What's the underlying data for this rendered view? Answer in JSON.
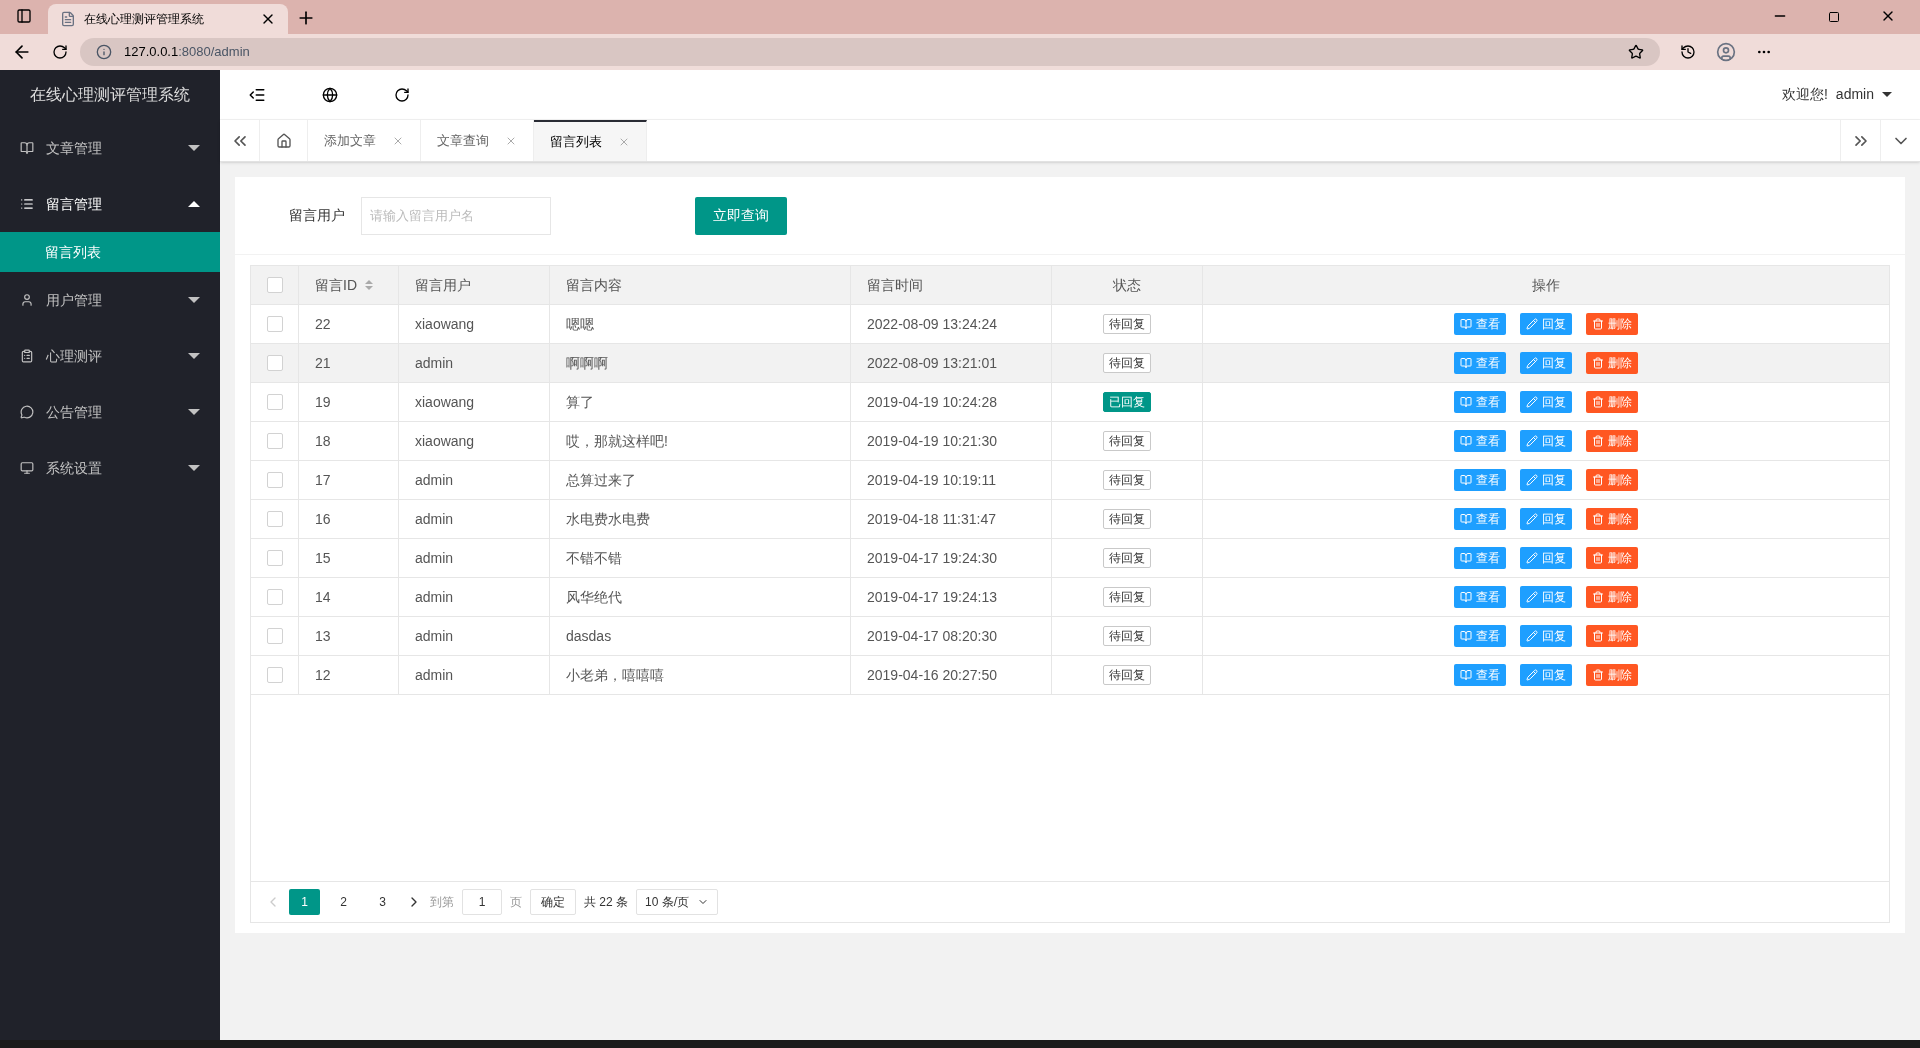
{
  "browser": {
    "tab_title": "在线心理测评管理系统",
    "url_host": "127.0.0.1",
    "url_rest": ":8080/admin"
  },
  "sidebar": {
    "title": "在线心理测评管理系统",
    "items": [
      {
        "label": "文章管理",
        "expanded": false
      },
      {
        "label": "留言管理",
        "expanded": true,
        "children": [
          {
            "label": "留言列表",
            "selected": true
          }
        ]
      },
      {
        "label": "用户管理",
        "expanded": false
      },
      {
        "label": "心理测评",
        "expanded": false
      },
      {
        "label": "公告管理",
        "expanded": false
      },
      {
        "label": "系统设置",
        "expanded": false
      }
    ]
  },
  "header": {
    "welcome": "欢迎您!",
    "user": "admin"
  },
  "tabs": [
    {
      "label": "添加文章",
      "selected": false
    },
    {
      "label": "文章查询",
      "selected": false
    },
    {
      "label": "留言列表",
      "selected": true
    }
  ],
  "search": {
    "label": "留言用户",
    "placeholder": "请输入留言用户名",
    "button": "立即查询"
  },
  "table": {
    "select_all": false,
    "columns": [
      "留言ID",
      "留言用户",
      "留言内容",
      "留言时间",
      "状态",
      "操作"
    ],
    "rows": [
      {
        "id": "22",
        "user": "xiaowang",
        "content": "嗯嗯",
        "time": "2022-08-09 13:24:24",
        "status": "待回复",
        "replied": false,
        "checked": false,
        "selected": false,
        "actions": [
          {
            "label": "查看",
            "kind": "view"
          },
          {
            "label": "回复",
            "kind": "reply"
          },
          {
            "label": "删除",
            "kind": "delete"
          }
        ]
      },
      {
        "id": "21",
        "user": "admin",
        "content": "啊啊啊",
        "time": "2022-08-09 13:21:01",
        "status": "待回复",
        "replied": false,
        "checked": false,
        "selected": true,
        "actions": [
          {
            "label": "查看",
            "kind": "view"
          },
          {
            "label": "回复",
            "kind": "reply"
          },
          {
            "label": "删除",
            "kind": "delete"
          }
        ]
      },
      {
        "id": "19",
        "user": "xiaowang",
        "content": "算了",
        "time": "2019-04-19 10:24:28",
        "status": "已回复",
        "replied": true,
        "checked": false,
        "selected": false,
        "actions": [
          {
            "label": "查看",
            "kind": "view"
          },
          {
            "label": "回复",
            "kind": "reply"
          },
          {
            "label": "删除",
            "kind": "delete"
          }
        ]
      },
      {
        "id": "18",
        "user": "xiaowang",
        "content": "哎，那就这样吧!",
        "time": "2019-04-19 10:21:30",
        "status": "待回复",
        "replied": false,
        "checked": false,
        "selected": false,
        "actions": [
          {
            "label": "查看",
            "kind": "view"
          },
          {
            "label": "回复",
            "kind": "reply"
          },
          {
            "label": "删除",
            "kind": "delete"
          }
        ]
      },
      {
        "id": "17",
        "user": "admin",
        "content": "总算过来了",
        "time": "2019-04-19 10:19:11",
        "status": "待回复",
        "replied": false,
        "checked": false,
        "selected": false,
        "actions": [
          {
            "label": "查看",
            "kind": "view"
          },
          {
            "label": "回复",
            "kind": "reply"
          },
          {
            "label": "删除",
            "kind": "delete"
          }
        ]
      },
      {
        "id": "16",
        "user": "admin",
        "content": "水电费水电费",
        "time": "2019-04-18 11:31:47",
        "status": "待回复",
        "replied": false,
        "checked": false,
        "selected": false,
        "actions": [
          {
            "label": "查看",
            "kind": "view"
          },
          {
            "label": "回复",
            "kind": "reply"
          },
          {
            "label": "删除",
            "kind": "delete"
          }
        ]
      },
      {
        "id": "15",
        "user": "admin",
        "content": "不错不错",
        "time": "2019-04-17 19:24:30",
        "status": "待回复",
        "replied": false,
        "checked": false,
        "selected": false,
        "actions": [
          {
            "label": "查看",
            "kind": "view"
          },
          {
            "label": "回复",
            "kind": "reply"
          },
          {
            "label": "删除",
            "kind": "delete"
          }
        ]
      },
      {
        "id": "14",
        "user": "admin",
        "content": "风华绝代",
        "time": "2019-04-17 19:24:13",
        "status": "待回复",
        "replied": false,
        "checked": false,
        "selected": false,
        "actions": [
          {
            "label": "查看",
            "kind": "view"
          },
          {
            "label": "回复",
            "kind": "reply"
          },
          {
            "label": "删除",
            "kind": "delete"
          }
        ]
      },
      {
        "id": "13",
        "user": "admin",
        "content": "dasdas",
        "time": "2019-04-17 08:20:30",
        "status": "待回复",
        "replied": false,
        "checked": false,
        "selected": false,
        "actions": [
          {
            "label": "查看",
            "kind": "view"
          },
          {
            "label": "回复",
            "kind": "reply"
          },
          {
            "label": "删除",
            "kind": "delete"
          }
        ]
      },
      {
        "id": "12",
        "user": "admin",
        "content": "小老弟，嘻嘻嘻",
        "time": "2019-04-16 20:27:50",
        "status": "待回复",
        "replied": false,
        "checked": false,
        "selected": false,
        "actions": [
          {
            "label": "查看",
            "kind": "view"
          },
          {
            "label": "回复",
            "kind": "reply"
          },
          {
            "label": "删除",
            "kind": "delete"
          }
        ]
      }
    ]
  },
  "pagination": {
    "pages": [
      {
        "label": "1",
        "selected": true
      },
      {
        "label": "2",
        "selected": false
      },
      {
        "label": "3",
        "selected": false
      }
    ],
    "goto_label": "到第",
    "goto_value": "1",
    "page_unit": "页",
    "confirm": "确定",
    "total": "共 22 条",
    "page_size": "10 条/页"
  }
}
